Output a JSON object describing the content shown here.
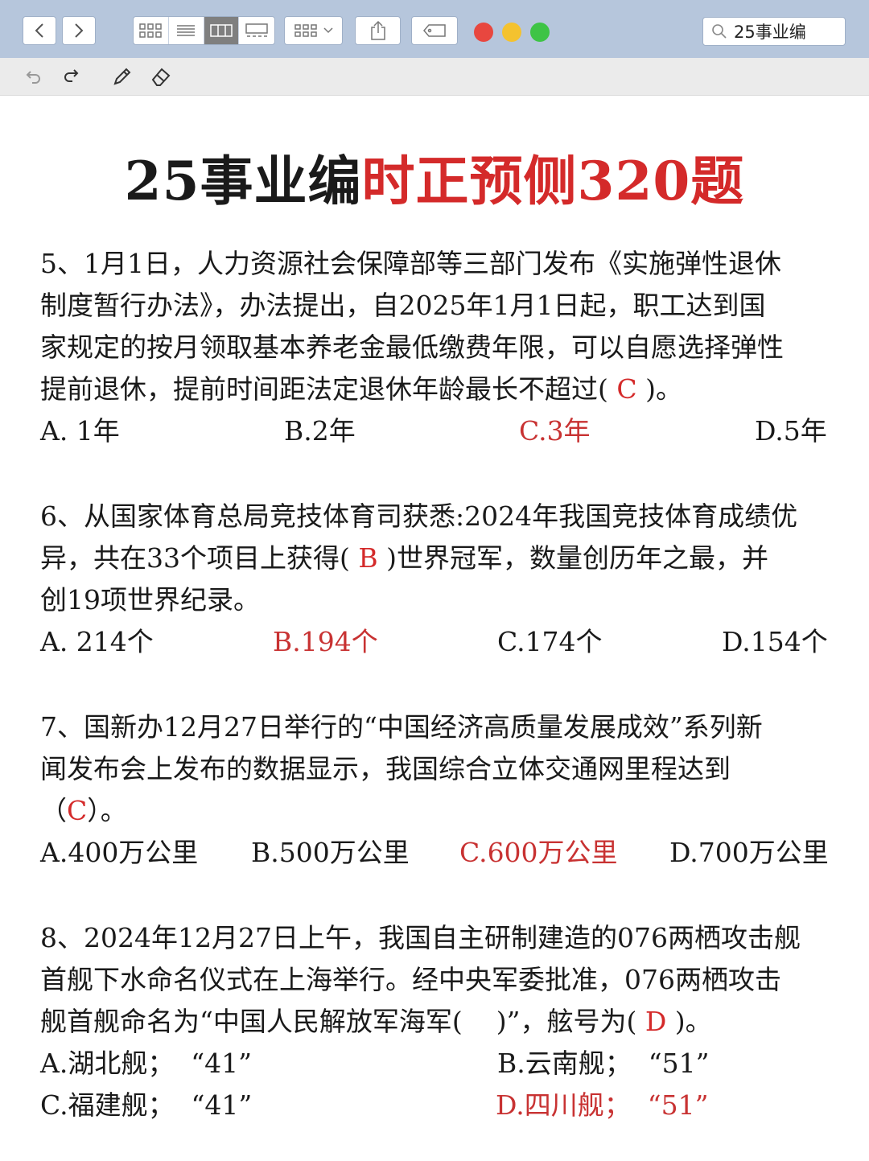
{
  "search": {
    "value": "25事业编"
  },
  "title": {
    "black": "25事业编",
    "red": "时正预侧320题"
  },
  "questions": [
    {
      "stem": [
        "5、1月1日，人力资源社会保障部等三部门发布《实施弹性退休",
        "制度暂行办法》，办法提出，自2025年1月1日起，职工达到国",
        "家规定的按月领取基本养老金最低缴费年限，可以自愿选择弹性"
      ],
      "last_pre": "提前退休，提前时间距法定退休年龄最长不超过(",
      "answer": "C",
      "last_post": ")。",
      "options": [
        "A. 1年",
        "B.2年",
        "C.3年",
        "D.5年"
      ]
    },
    {
      "stem": [
        "6、从国家体育总局竞技体育司获悉:2024年我国竞技体育成绩优"
      ],
      "mid_pre": "异，共在33个项目上获得(",
      "answer": "B",
      "mid_post": ")世界冠军，数量创历年之最，并",
      "tail": "创19项世界纪录。",
      "options": [
        "A. 214个",
        "B.194个",
        "C.174个",
        "D.154个"
      ]
    },
    {
      "stem": [
        "7、国新办12月27日举行的“中国经济高质量发展成效”系列新",
        "闻发布会上发布的数据显示，我国综合立体交通网里程达到"
      ],
      "last_pre": "（",
      "answer": "C",
      "last_post": "）。",
      "options": [
        "A.400万公里",
        "B.500万公里",
        "C.600万公里",
        "D.700万公里"
      ]
    },
    {
      "stem": [
        "8、2024年12月27日上午，我国自主研制建造的076两栖攻击舰",
        "首舰下水命名仪式在上海举行。经中央军委批准，076两栖攻击"
      ],
      "last_pre": "舰首舰命名为“中国人民解放军海军(    )”，舷号为(",
      "answer": "D",
      "last_post": ")。",
      "options": [
        "A.湖北舰；  “41”",
        "B.云南舰；  “51”",
        "C.福建舰；  “41”",
        "D.四川舰；  “51”"
      ]
    }
  ],
  "colors": {
    "accent_red": "#d42a2a",
    "toolbar_bg": "#b6c6dc"
  }
}
